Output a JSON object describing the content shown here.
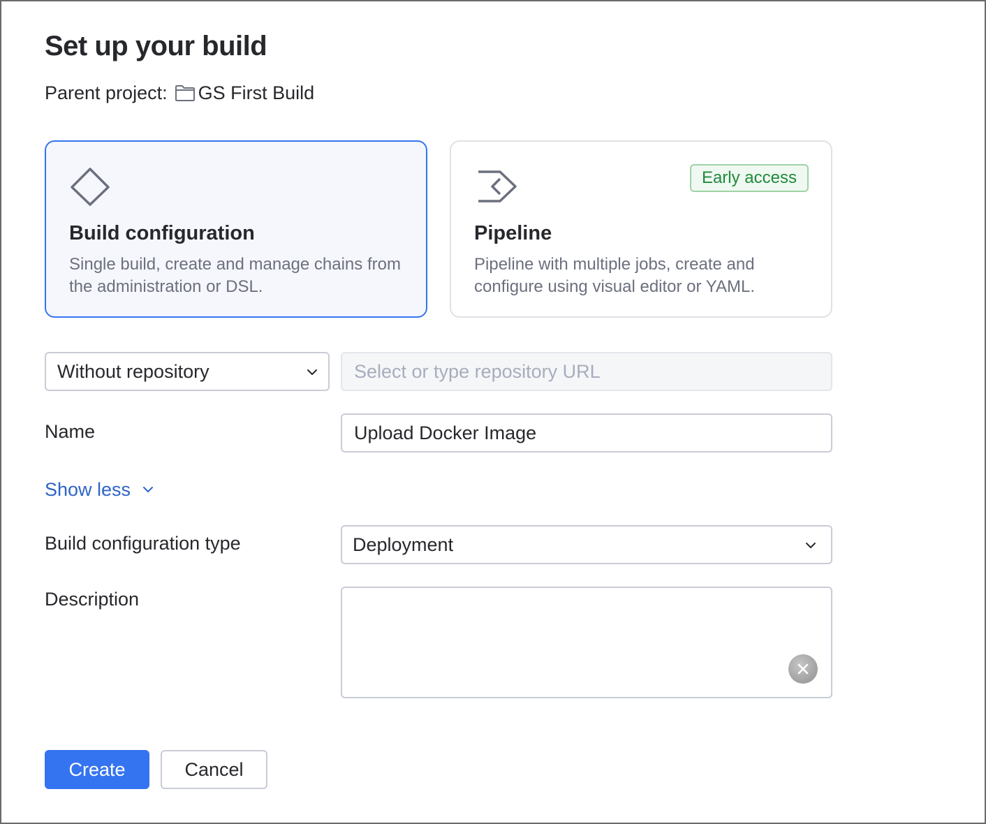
{
  "page": {
    "title": "Set up your build"
  },
  "parent_project": {
    "label": "Parent project:",
    "name": "GS First Build",
    "icon": "folder-icon"
  },
  "cards": [
    {
      "title": "Build configuration",
      "description": "Single build, create and manage chains from the administration or DSL.",
      "selected": true,
      "icon": "diamond-icon"
    },
    {
      "title": "Pipeline",
      "description": "Pipeline with multiple jobs, create and configure using visual editor or YAML.",
      "selected": false,
      "badge": "Early access",
      "icon": "pipeline-icon"
    }
  ],
  "repository": {
    "selected": "Without repository",
    "url_placeholder": "Select or type repository URL"
  },
  "name_field": {
    "label": "Name",
    "value": "Upload Docker Image"
  },
  "toggle": {
    "label": "Show less"
  },
  "config_type": {
    "label": "Build configuration type",
    "selected": "Deployment"
  },
  "description_field": {
    "label": "Description",
    "value": ""
  },
  "actions": {
    "create": "Create",
    "cancel": "Cancel"
  },
  "colors": {
    "accent": "#3574f0",
    "link": "#2f64c7",
    "badge_text": "#208a3c",
    "badge_border": "#9fd3a9"
  }
}
